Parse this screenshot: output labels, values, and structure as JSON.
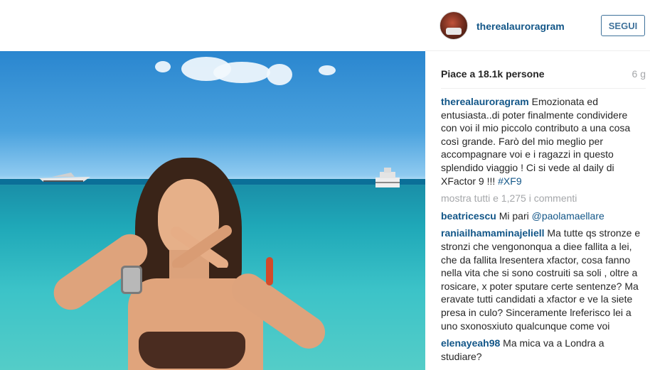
{
  "header": {
    "username": "therealauroragram",
    "follow_label": "SEGUI"
  },
  "post": {
    "likes": "Piace a 18.1k persone",
    "age": "6 g",
    "caption": {
      "user": "therealauroragram",
      "text": "Emozionata ed entusiasta..di poter finalmente condividere con voi il mio piccolo contributo a una cosa così grande. Farò del mio meglio per accompagnare voi e i ragazzi in questo splendido viaggio ! Ci si vede al daily di XFactor 9 !!! ",
      "hashtag": "#XF9"
    },
    "show_all": "mostra tutti e 1,275 i commenti",
    "comments": [
      {
        "user": "beatricescu",
        "text": "Mi pari ",
        "mention": "@paolamaellare"
      },
      {
        "user": "raniailhamaminajeliell",
        "text": "Ma tutte qs stronze e stronzi che vengononqua a diee fallita a lei, che da fallita lresentera xfactor, cosa fanno nella vita che si sono costruiti sa soli , oltre a rosicare, x poter sputare certe sentenze? Ma eravate tutti candidati a xfactor e ve la siete presa in culo? Sinceramente lreferisco lei a uno sxonosxiuto qualcunque come voi",
        "mention": ""
      },
      {
        "user": "elenayeah98",
        "text": "Ma mica va a Londra a studiare?",
        "mention": ""
      }
    ]
  },
  "icons": {
    "avatar": "profile-avatar"
  },
  "colors": {
    "link": "#125688",
    "follow": "#3f729b",
    "muted": "#a5a7aa"
  }
}
